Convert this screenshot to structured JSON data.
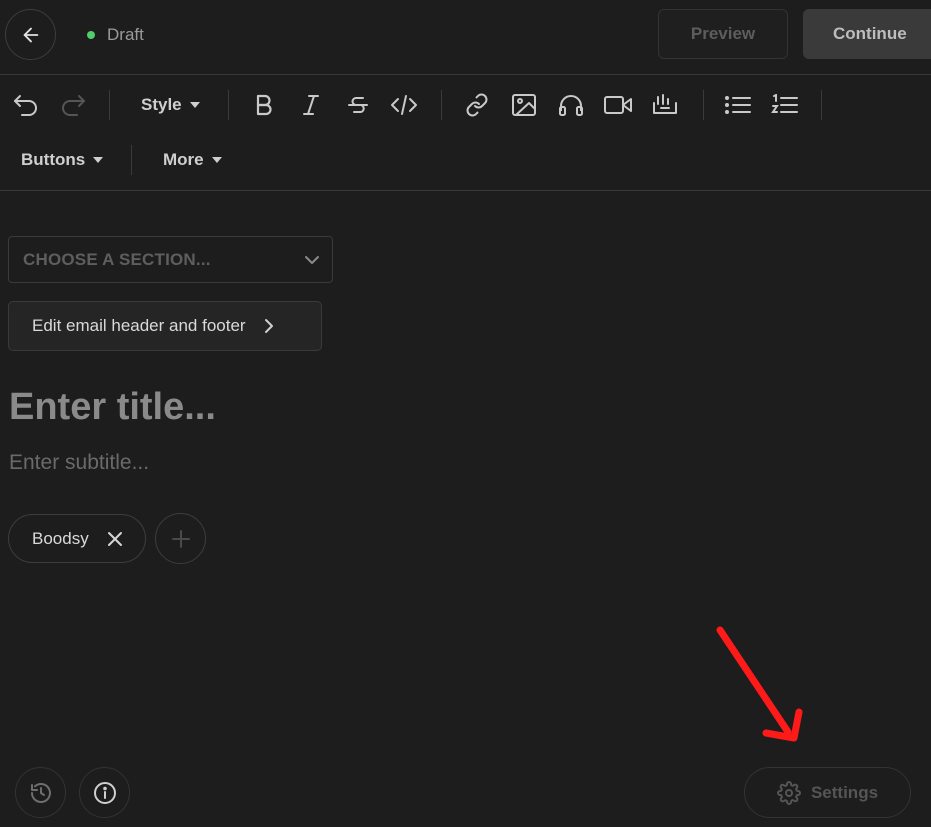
{
  "header": {
    "status_text": "Draft",
    "status_color": "#4fce6a",
    "preview_label": "Preview",
    "continue_label": "Continue"
  },
  "toolbar": {
    "row1": [
      "undo-icon",
      "redo-icon",
      "Style",
      "bold-icon",
      "italic-icon",
      "strikethrough-icon",
      "code-icon",
      "link-icon",
      "image-icon",
      "headphones-icon",
      "video-icon",
      "poll-icon",
      "bullet-list-icon",
      "numbered-list-icon"
    ],
    "style_label": "Style",
    "buttons_label": "Buttons",
    "more_label": "More"
  },
  "editor": {
    "section_placeholder": "CHOOSE A SECTION...",
    "edit_header_footer_label": "Edit email header and footer",
    "title_placeholder": "Enter title...",
    "subtitle_placeholder": "Enter subtitle...",
    "tags": [
      {
        "label": "Boodsy"
      }
    ]
  },
  "footer": {
    "settings_label": "Settings"
  },
  "annotation": {
    "arrow_color": "#ff1a1a"
  }
}
